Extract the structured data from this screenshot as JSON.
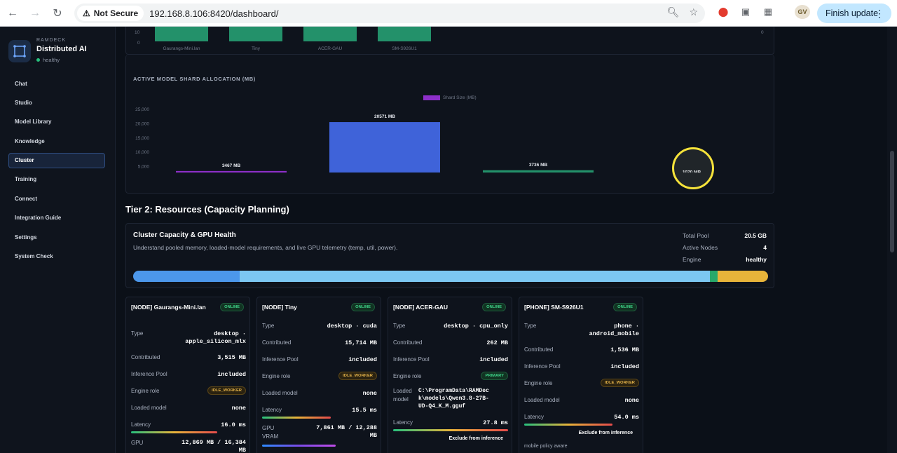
{
  "browser": {
    "security": "Not Secure",
    "url": "192.168.8.106:8420/dashboard/",
    "finish_update": "Finish update",
    "profile": "GV"
  },
  "brand": {
    "sub": "RAMDECK",
    "title": "Distributed AI",
    "status": "healthy"
  },
  "nav": [
    "Chat",
    "Studio",
    "Model Library",
    "Knowledge",
    "Cluster",
    "Training",
    "Connect",
    "Integration Guide",
    "Settings",
    "System Check"
  ],
  "nav_active": "Cluster",
  "top_chart": {
    "ticks": [
      "10",
      "0"
    ],
    "right_tick": "0",
    "categories": [
      "Gaurangs-Mini.lan",
      "Tiny",
      "ACER-GAU",
      "SM-S926U1"
    ]
  },
  "chart_data": {
    "type": "bar",
    "title": "ACTIVE MODEL SHARD ALLOCATION (MB)",
    "legend": "Shard Size (MB)",
    "categories": [
      "ACER-GAU",
      "Tiny",
      "Gaurangs-Mini.lan",
      "SM-S926U1"
    ],
    "values": [
      3467,
      20571,
      3736,
      1070
    ],
    "data_labels": [
      "3467 MB",
      "20571 MB",
      "3736 MB",
      "1070 MB"
    ],
    "colors": [
      "#8d2fc9",
      "#3f63d9",
      "#23916a",
      "#d08a22"
    ],
    "ylim": [
      0,
      25000
    ],
    "yticks": [
      "25,000",
      "20,000",
      "15,000",
      "10,000",
      "5,000",
      "0"
    ]
  },
  "tier2": {
    "heading": "Tier 2: Resources (Capacity Planning)"
  },
  "capacity": {
    "title": "Cluster Capacity & GPU Health",
    "subtitle": "Understand pooled memory, loaded-model requirements, and live GPU telemetry (temp, util, power).",
    "stats": [
      {
        "k": "Total Pool",
        "v": "20.5 GB"
      },
      {
        "k": "Active Nodes",
        "v": "4"
      },
      {
        "k": "Engine",
        "v": "healthy"
      }
    ],
    "segments": [
      {
        "frac": 0.168,
        "color": "#4c97ea"
      },
      {
        "frac": 0.74,
        "color": "#7cc7f2"
      },
      {
        "frac": 0.013,
        "color": "#27a86b"
      },
      {
        "frac": 0.079,
        "color": "#e8b43a"
      }
    ]
  },
  "labels": {
    "type": "Type",
    "contributed": "Contributed",
    "inference_pool": "Inference Pool",
    "engine_role": "Engine role",
    "loaded_model": "Loaded model",
    "latency": "Latency",
    "gpu": "GPU",
    "gpu_vram": "GPU VRAM",
    "exclude": "Exclude from inference",
    "mobile_note": "mobile policy aware"
  },
  "nodes": [
    {
      "title": "[NODE] Gaurangs-Mini.lan",
      "status": "ONLINE",
      "type": "desktop · apple_silicon_mlx",
      "contributed": "3,515 MB",
      "pool": "included",
      "role": "IDLE_WORKER",
      "model": "none",
      "latency": "16.0 ms",
      "latency_level": 0.75,
      "gpu": "12,869 MB / 16,384",
      "gpu_tail": "MB"
    },
    {
      "title": "[NODE] Tiny",
      "status": "ONLINE",
      "type": "desktop · cuda",
      "contributed": "15,714 MB",
      "pool": "included",
      "role": "IDLE_WORKER",
      "model": "none",
      "latency": "15.5 ms",
      "latency_level": 0.6,
      "gpu": "7,861 MB / 12,288 MB",
      "gpu_level": 0.64
    },
    {
      "title": "[NODE] ACER-GAU",
      "status": "ONLINE",
      "type": "desktop · cpu_only",
      "contributed": "262 MB",
      "pool": "included",
      "role": "PRIMARY",
      "model": "C:\\ProgramData\\RAMDeck\\models\\Qwen3.8-27B-UD-Q4_K_M.gguf",
      "model_display": [
        "C:\\ProgramData\\RAMDec",
        "k\\models\\Qwen3.8-27B-",
        "UD-Q4_K_M.gguf"
      ],
      "latency": "27.8 ms",
      "latency_level": 1.0
    },
    {
      "title": "[PHONE] SM-S926U1",
      "status": "ONLINE",
      "type": "phone · android_mobile",
      "contributed": "1,536 MB",
      "pool": "included",
      "role": "IDLE_WORKER",
      "model": "none",
      "latency": "54.0 ms",
      "latency_level": 0.77
    }
  ]
}
